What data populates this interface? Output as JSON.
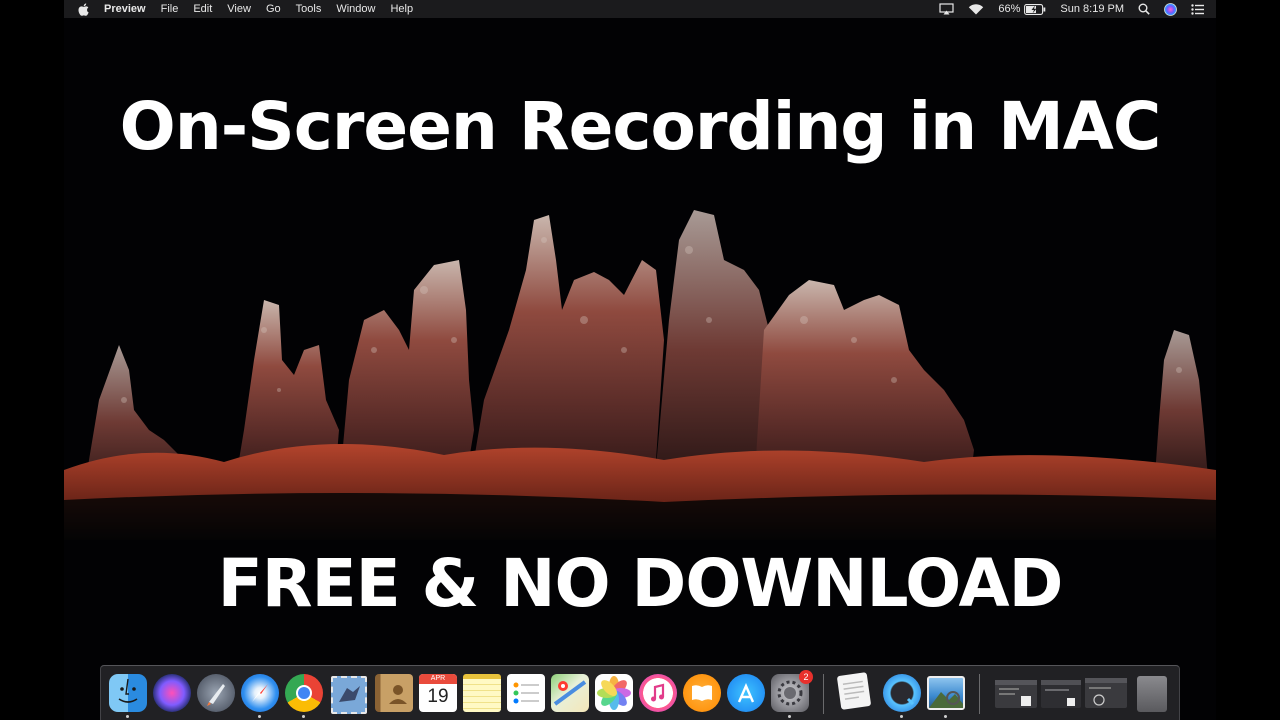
{
  "menubar": {
    "app_name": "Preview",
    "menus": [
      "File",
      "Edit",
      "View",
      "Go",
      "Tools",
      "Window",
      "Help"
    ],
    "battery_percent": "66%",
    "clock": "Sun 8:19 PM"
  },
  "title": "On-Screen Recording in MAC",
  "subtitle": "FREE & NO DOWNLOAD",
  "calendar": {
    "month": "APR",
    "day": "19"
  },
  "system_prefs_badge": "2",
  "dock_items": [
    "finder-icon",
    "siri-icon",
    "launchpad-icon",
    "safari-icon",
    "chrome-icon",
    "mail-icon",
    "contacts-icon",
    "calendar-icon",
    "notes-icon",
    "reminders-icon",
    "maps-icon",
    "photos-icon",
    "itunes-icon",
    "ibooks-icon",
    "app-store-icon",
    "system-preferences-icon",
    "textedit-icon",
    "quicktime-icon",
    "preview-icon",
    "window-thumbnail-icon",
    "trash-icon"
  ]
}
